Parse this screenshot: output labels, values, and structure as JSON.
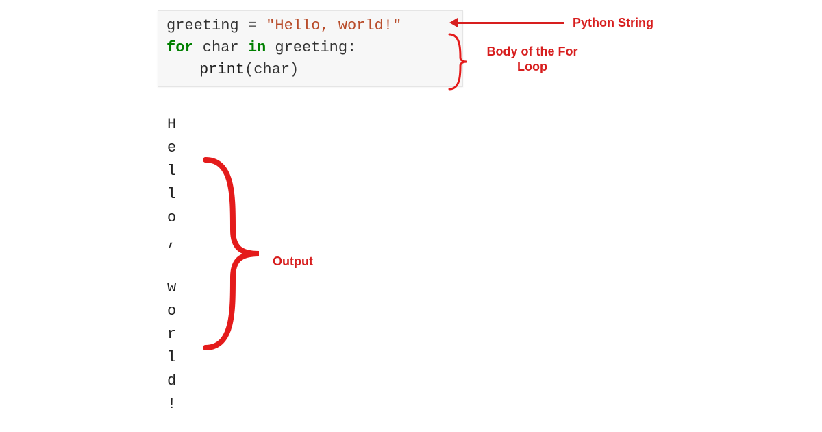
{
  "code": {
    "line1": {
      "var": "greeting",
      "eq": " = ",
      "string": "\"Hello, world!\""
    },
    "line2": {
      "for": "for",
      "var2": " char ",
      "in": "in",
      "iter": " greeting:"
    },
    "line3": {
      "fn": "print",
      "paren_open": "(",
      "arg": "char",
      "paren_close": ")"
    }
  },
  "output_chars": [
    "H",
    "e",
    "l",
    "l",
    "o",
    ",",
    " ",
    "w",
    "o",
    "r",
    "l",
    "d",
    "!"
  ],
  "annotations": {
    "python_string": "Python String",
    "body_loop": "Body of the For Loop",
    "output": "Output"
  }
}
